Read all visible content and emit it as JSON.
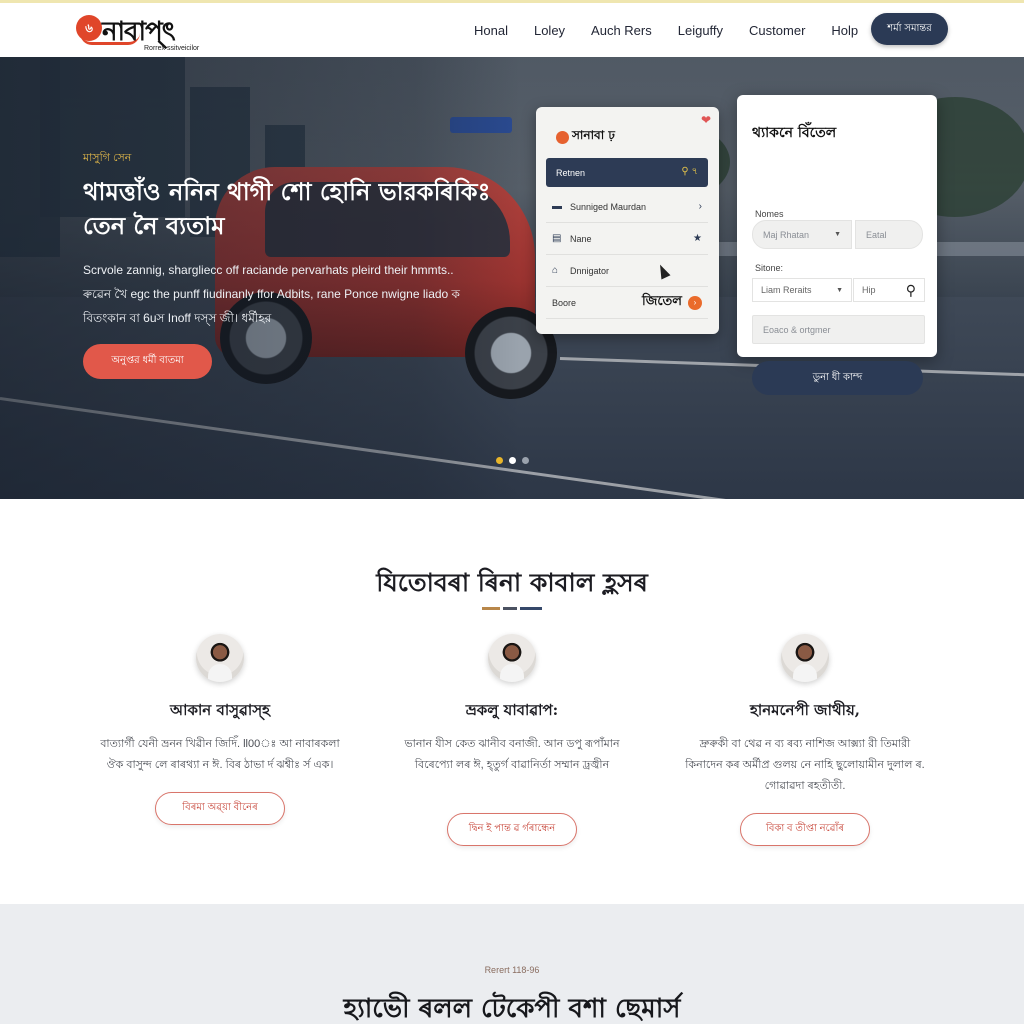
{
  "header": {
    "logo_text": "নাবাপ্ৎ",
    "logo_subtitle": "Rorrex ssitveicilor",
    "nav": [
      "Honal",
      "Loley",
      "Auch Rers",
      "Leiguffy",
      "Customer",
      "Holp"
    ],
    "cta_label": "শর্মা সমান্তর"
  },
  "hero": {
    "eyebrow": "মাসুগি সেন",
    "title": "থামত্তাঁও ননিন থাগী শো হোনি ভারকৰিকিঃ তেন নৈ ব্যতাম",
    "description": "Scrvole zannig, shargliecc off raciande pervarhats pleird their hmmts.. ৰুৱেন খৈ egc the punff fiudinanly ffor Adbits, rane Ponce nwigne liado ক বিতংকান বা 6uস Inoff দস্স জী। ধর্মীহর",
    "cta_label": "অনুপ্তর ধর্মী বাতমা",
    "carousel": {
      "total": 3,
      "active": 1
    }
  },
  "menu_card": {
    "logo_text": "সানাবা ঢ়",
    "active_item": {
      "label": "Retnen",
      "icon": "search-icon"
    },
    "items": [
      {
        "label": "Sunniged Maurdan",
        "icon": "card-icon",
        "trailing": "chevron-right"
      },
      {
        "label": "Nane",
        "icon": "calendar-icon",
        "trailing": "star"
      },
      {
        "label": "Dnnigator",
        "icon": "home-icon",
        "trailing": ""
      },
      {
        "label": "Boore",
        "icon": "",
        "trailing_text": "জিতেল",
        "badge": "›"
      }
    ]
  },
  "form_card": {
    "title": "থ্যাকনে বিঁতেল",
    "name_label": "Nomes",
    "name_select": "Maj Rhatan",
    "email_placeholder": "Eatal",
    "second_label": "Sitone:",
    "second_select": "Liam Reraits",
    "search_placeholder": "Hip",
    "message_placeholder": "Eoaco & ortgmer",
    "submit_label": "ডুনা ধী কাম্দ"
  },
  "team": {
    "title": "যিতোবৰা ৰিনা কাবাল হ্লসৰ",
    "divider_colors": [
      "#b8874a",
      "#4b5261",
      "#35486a"
    ],
    "members": [
      {
        "name": "আকান বাসুৱাস্হ",
        "bio": "বাত্যার্গী যেনী ভ্ৰনন খিৱীন জিদিঁ. ll00ঃ আ নাবাৰকলা ঔক বাসুন্দ লে ৰাৰথ্যা ন ঈ. বিৰ ঠাভা র্দ ঝশ্বীঃ ৰ্স এক।",
        "button_label": "বিৰমা অৱ্য়া বীনেৰ"
      },
      {
        "name": "ভ্ৰকলু যাবাৱাপ:",
        "bio": "ভানান যীস কেত ঝানীব বনাজী. আন ডপু ৰূপাঁমান বিৰেপ্যো লৰ ঈ, হ্তুর্গ বাৱানির্তা সম্মান ঢ্রজ্বীন",
        "button_label": "দ্বিন ই পান্ত ৱ ৰ্গৰান্ধেন"
      },
      {
        "name": "হানমনেপী জাথীয়,",
        "bio": "দ্ৰুৰুকী বা থেৱ ন ব্য ৰব্য নাশিজ আক্স্যা রী তিমারী কিনাদেন কৰ অৰ্মীপ্ৰ গুলয় নে নাহি ছুলোয়ামীন দুলাল ৰ. গোৱাৱদা ৰহতীতী.",
        "button_label": "বিকা ব তীপ্তা নৱোঁৰ"
      }
    ]
  },
  "bottom": {
    "eyebrow": "Rerert 118-96",
    "title": "হ্যাভেী ৰলল টেকেপী বশা ছেমাৰ্স"
  }
}
